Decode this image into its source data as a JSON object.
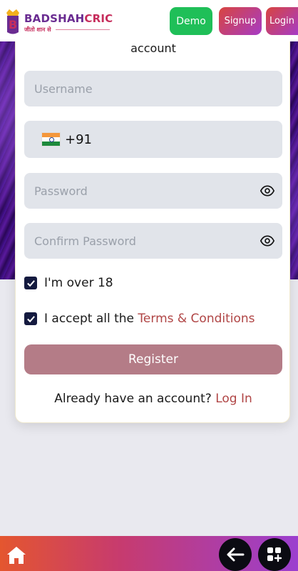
{
  "header": {
    "logo_part_a": "BADSHAH",
    "logo_part_b": "CRIC",
    "logo_tagline": "जीतो शान से",
    "buttons": {
      "demo": "Demo",
      "signup": "Signup",
      "login": "Login"
    }
  },
  "form": {
    "title": "account",
    "username_placeholder": "Username",
    "phone_code": "+91",
    "password_placeholder": "Password",
    "confirm_password_placeholder": "Confirm Password",
    "over18_label": "I'm over 18",
    "over18_checked": true,
    "accept_prefix": "I accept all the ",
    "terms_link": "Terms & Conditions",
    "accept_checked": true,
    "register_label": "Register",
    "already_text": "Already have an account? ",
    "login_link": "Log In"
  },
  "colors": {
    "demo": "#1fbf58",
    "accent_link": "#b04545",
    "register_bg": "#b47c87",
    "checkbox": "#141a3f"
  },
  "icons": {
    "logo": "crown-badge-icon",
    "flag": "india-flag-icon",
    "eye": "eye-icon",
    "home": "home-icon",
    "back": "arrow-left-icon",
    "grid": "grid-icon"
  }
}
